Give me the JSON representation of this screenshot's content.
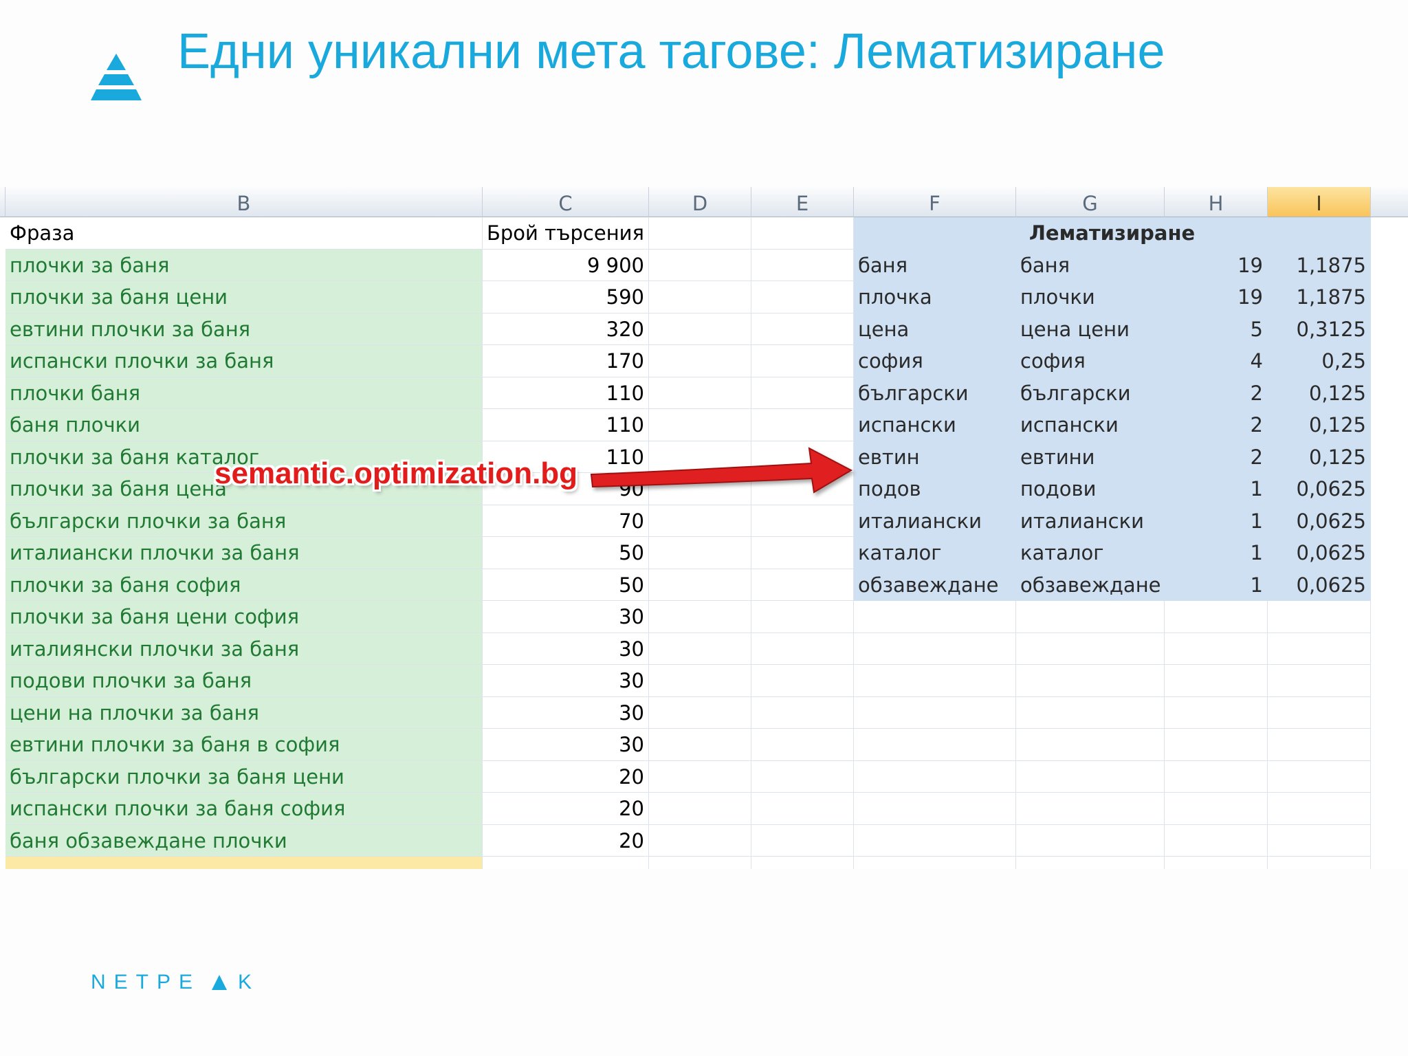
{
  "slide": {
    "title": "Едни уникални мета тагове: Лематизиране",
    "logo_color": "#1aa9dc",
    "brand_letters_left": [
      "N",
      "E",
      "T",
      "P",
      "E"
    ],
    "brand_letters_right": [
      "K"
    ],
    "watermark": "semantic.optimization.bg"
  },
  "sheet": {
    "columns": [
      "B",
      "C",
      "D",
      "E",
      "F",
      "G",
      "H",
      "I"
    ],
    "selected_column": "I",
    "phrase_header": "Фраза",
    "count_header": "Брой търсения",
    "lemma_header": "Лематизиране",
    "phrases": [
      {
        "phrase": "плочки за баня",
        "count": "9 900"
      },
      {
        "phrase": "плочки за баня цени",
        "count": "590"
      },
      {
        "phrase": "евтини плочки за баня",
        "count": "320"
      },
      {
        "phrase": "испански плочки за баня",
        "count": "170"
      },
      {
        "phrase": "плочки баня",
        "count": "110"
      },
      {
        "phrase": "баня плочки",
        "count": "110"
      },
      {
        "phrase": "плочки за баня каталог",
        "count": "110"
      },
      {
        "phrase": "плочки за баня цена",
        "count": "90"
      },
      {
        "phrase": "български плочки за баня",
        "count": "70"
      },
      {
        "phrase": "италиански плочки за баня",
        "count": "50"
      },
      {
        "phrase": "плочки за баня софия",
        "count": "50"
      },
      {
        "phrase": "плочки за баня цени софия",
        "count": "30"
      },
      {
        "phrase": "италиянски плочки за баня",
        "count": "30"
      },
      {
        "phrase": "подови плочки за баня",
        "count": "30"
      },
      {
        "phrase": "цени на плочки за баня",
        "count": "30"
      },
      {
        "phrase": "евтини плочки за баня в софия",
        "count": "30"
      },
      {
        "phrase": "български плочки за баня цени",
        "count": "20"
      },
      {
        "phrase": "испански плочки за баня софия",
        "count": "20"
      },
      {
        "phrase": "баня обзавеждане плочки",
        "count": "20"
      }
    ],
    "lemmas": [
      {
        "lemma": "баня",
        "forms": "баня",
        "count": "19",
        "weight": "1,1875"
      },
      {
        "lemma": "плочка",
        "forms": "плочки",
        "count": "19",
        "weight": "1,1875"
      },
      {
        "lemma": "цена",
        "forms": "цена цени",
        "count": "5",
        "weight": "0,3125"
      },
      {
        "lemma": "софия",
        "forms": "софия",
        "count": "4",
        "weight": "0,25"
      },
      {
        "lemma": "български",
        "forms": "български",
        "count": "2",
        "weight": "0,125"
      },
      {
        "lemma": "испански",
        "forms": "испански",
        "count": "2",
        "weight": "0,125"
      },
      {
        "lemma": "евтин",
        "forms": "евтини",
        "count": "2",
        "weight": "0,125"
      },
      {
        "lemma": "подов",
        "forms": "подови",
        "count": "1",
        "weight": "0,0625"
      },
      {
        "lemma": "италиански",
        "forms": "италиански",
        "count": "1",
        "weight": "0,0625"
      },
      {
        "lemma": "каталог",
        "forms": "каталог",
        "count": "1",
        "weight": "0,0625"
      },
      {
        "lemma": "обзавеждане",
        "forms": "обзавеждане",
        "count": "1",
        "weight": "0,0625"
      }
    ]
  }
}
